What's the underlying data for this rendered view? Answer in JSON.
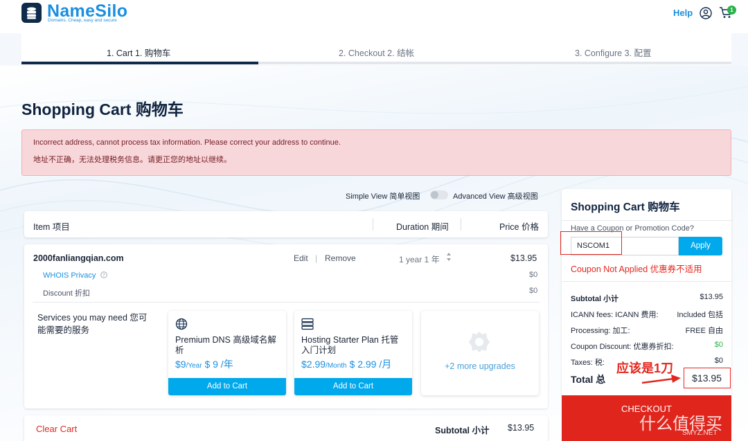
{
  "brand": {
    "name": "NameSilo",
    "tagline": "Domains. Cheap, easy and secure"
  },
  "header": {
    "help": "Help",
    "cart_count": "1"
  },
  "steps": [
    {
      "label": "1. Cart 1. 购物车",
      "active": true
    },
    {
      "label": "2. Checkout 2. 结帐",
      "active": false
    },
    {
      "label": "3. Configure 3. 配置",
      "active": false
    }
  ],
  "page_title": "Shopping Cart 购物车",
  "alert": {
    "line1": "Incorrect address, cannot process tax information. Please correct your address to continue.",
    "line2": "地址不正确，无法处理税务信息。请更正您的地址以继续。"
  },
  "view": {
    "simple": "Simple View 简单视图",
    "advanced": "Advanced View 高级视图",
    "advanced_on": false
  },
  "cart_head": {
    "item": "Item 项目",
    "duration": "Duration 期间",
    "price": "Price 价格"
  },
  "cart_item": {
    "domain": "2000fanliangqian.com",
    "edit": "Edit",
    "remove": "Remove",
    "duration": "1 year 1 年",
    "price": "$13.95",
    "whois": "WHOIS Privacy",
    "whois_price": "$0",
    "discount": "Discount 折扣",
    "discount_price": "$0"
  },
  "services": {
    "heading": "Services you may need 您可能需要的服务",
    "cards": [
      {
        "title": "Premium DNS 高级域名解析",
        "price": "$9",
        "unit": "/Year",
        "price_cn": "$ 9 /年",
        "button": "Add to Cart"
      },
      {
        "title": "Hosting Starter Plan 托管入门计划",
        "price": "$2.99",
        "unit": "/Month",
        "price_cn": "$ 2.99 /月",
        "button": "Add to Cart"
      }
    ],
    "more": "+2 more upgrades"
  },
  "bottom": {
    "clear": "Clear Cart",
    "subtotal_label": "Subtotal 小计",
    "subtotal": "$13.95"
  },
  "summary": {
    "title": "Shopping Cart 购物车",
    "coupon_label": "Have a Coupon or Promotion Code?",
    "coupon_value": "NSCOM1",
    "apply": "Apply",
    "coupon_note": "Coupon Not Applied 优惠券不适用",
    "rows": [
      {
        "label": "Subtotal 小计",
        "value": "$13.95"
      },
      {
        "label": "ICANN fees: ICANN 费用:",
        "value": "Included 包括"
      },
      {
        "label": "Processing: 加工:",
        "value": "FREE 自由"
      },
      {
        "label": "Coupon Discount: 优惠券折扣:",
        "value": "$0"
      },
      {
        "label": "Taxes: 税:",
        "value": "$0"
      }
    ],
    "total_label": "Total 总",
    "total": "$13.95",
    "checkout": "CHECKOUT"
  },
  "annotation": {
    "text": "应该是1刀"
  },
  "watermark": {
    "main": "什么值得买",
    "sub": "SMYZ.NET"
  },
  "colors": {
    "brand": "#1a8fe0",
    "accent": "#00a8ec",
    "danger": "#e3261d",
    "success": "#2bb34a",
    "navy": "#0f2a4a"
  }
}
